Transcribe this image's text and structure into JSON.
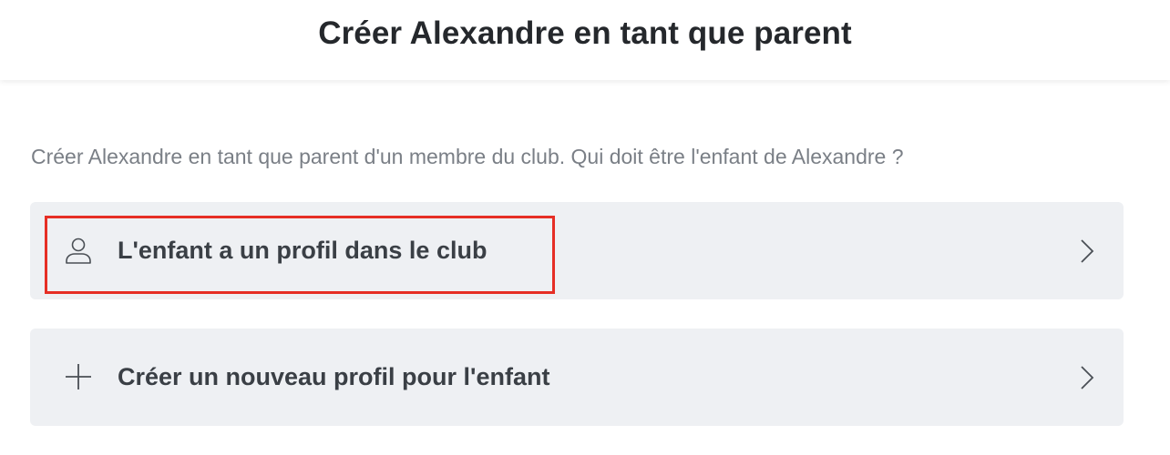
{
  "header": {
    "title": "Créer Alexandre en tant que parent"
  },
  "intro": {
    "text": "Créer Alexandre en tant que parent d'un membre du club. Qui doit être l'enfant de Alexandre ?"
  },
  "options": [
    {
      "label": "L'enfant a un profil dans le club",
      "icon": "user-icon",
      "highlighted": true
    },
    {
      "label": "Créer un nouveau profil pour l'enfant",
      "icon": "plus-icon",
      "highlighted": false
    }
  ],
  "colors": {
    "highlight": "#e62e25",
    "option_bg": "#eef0f3",
    "intro_text": "#7a7f86"
  }
}
